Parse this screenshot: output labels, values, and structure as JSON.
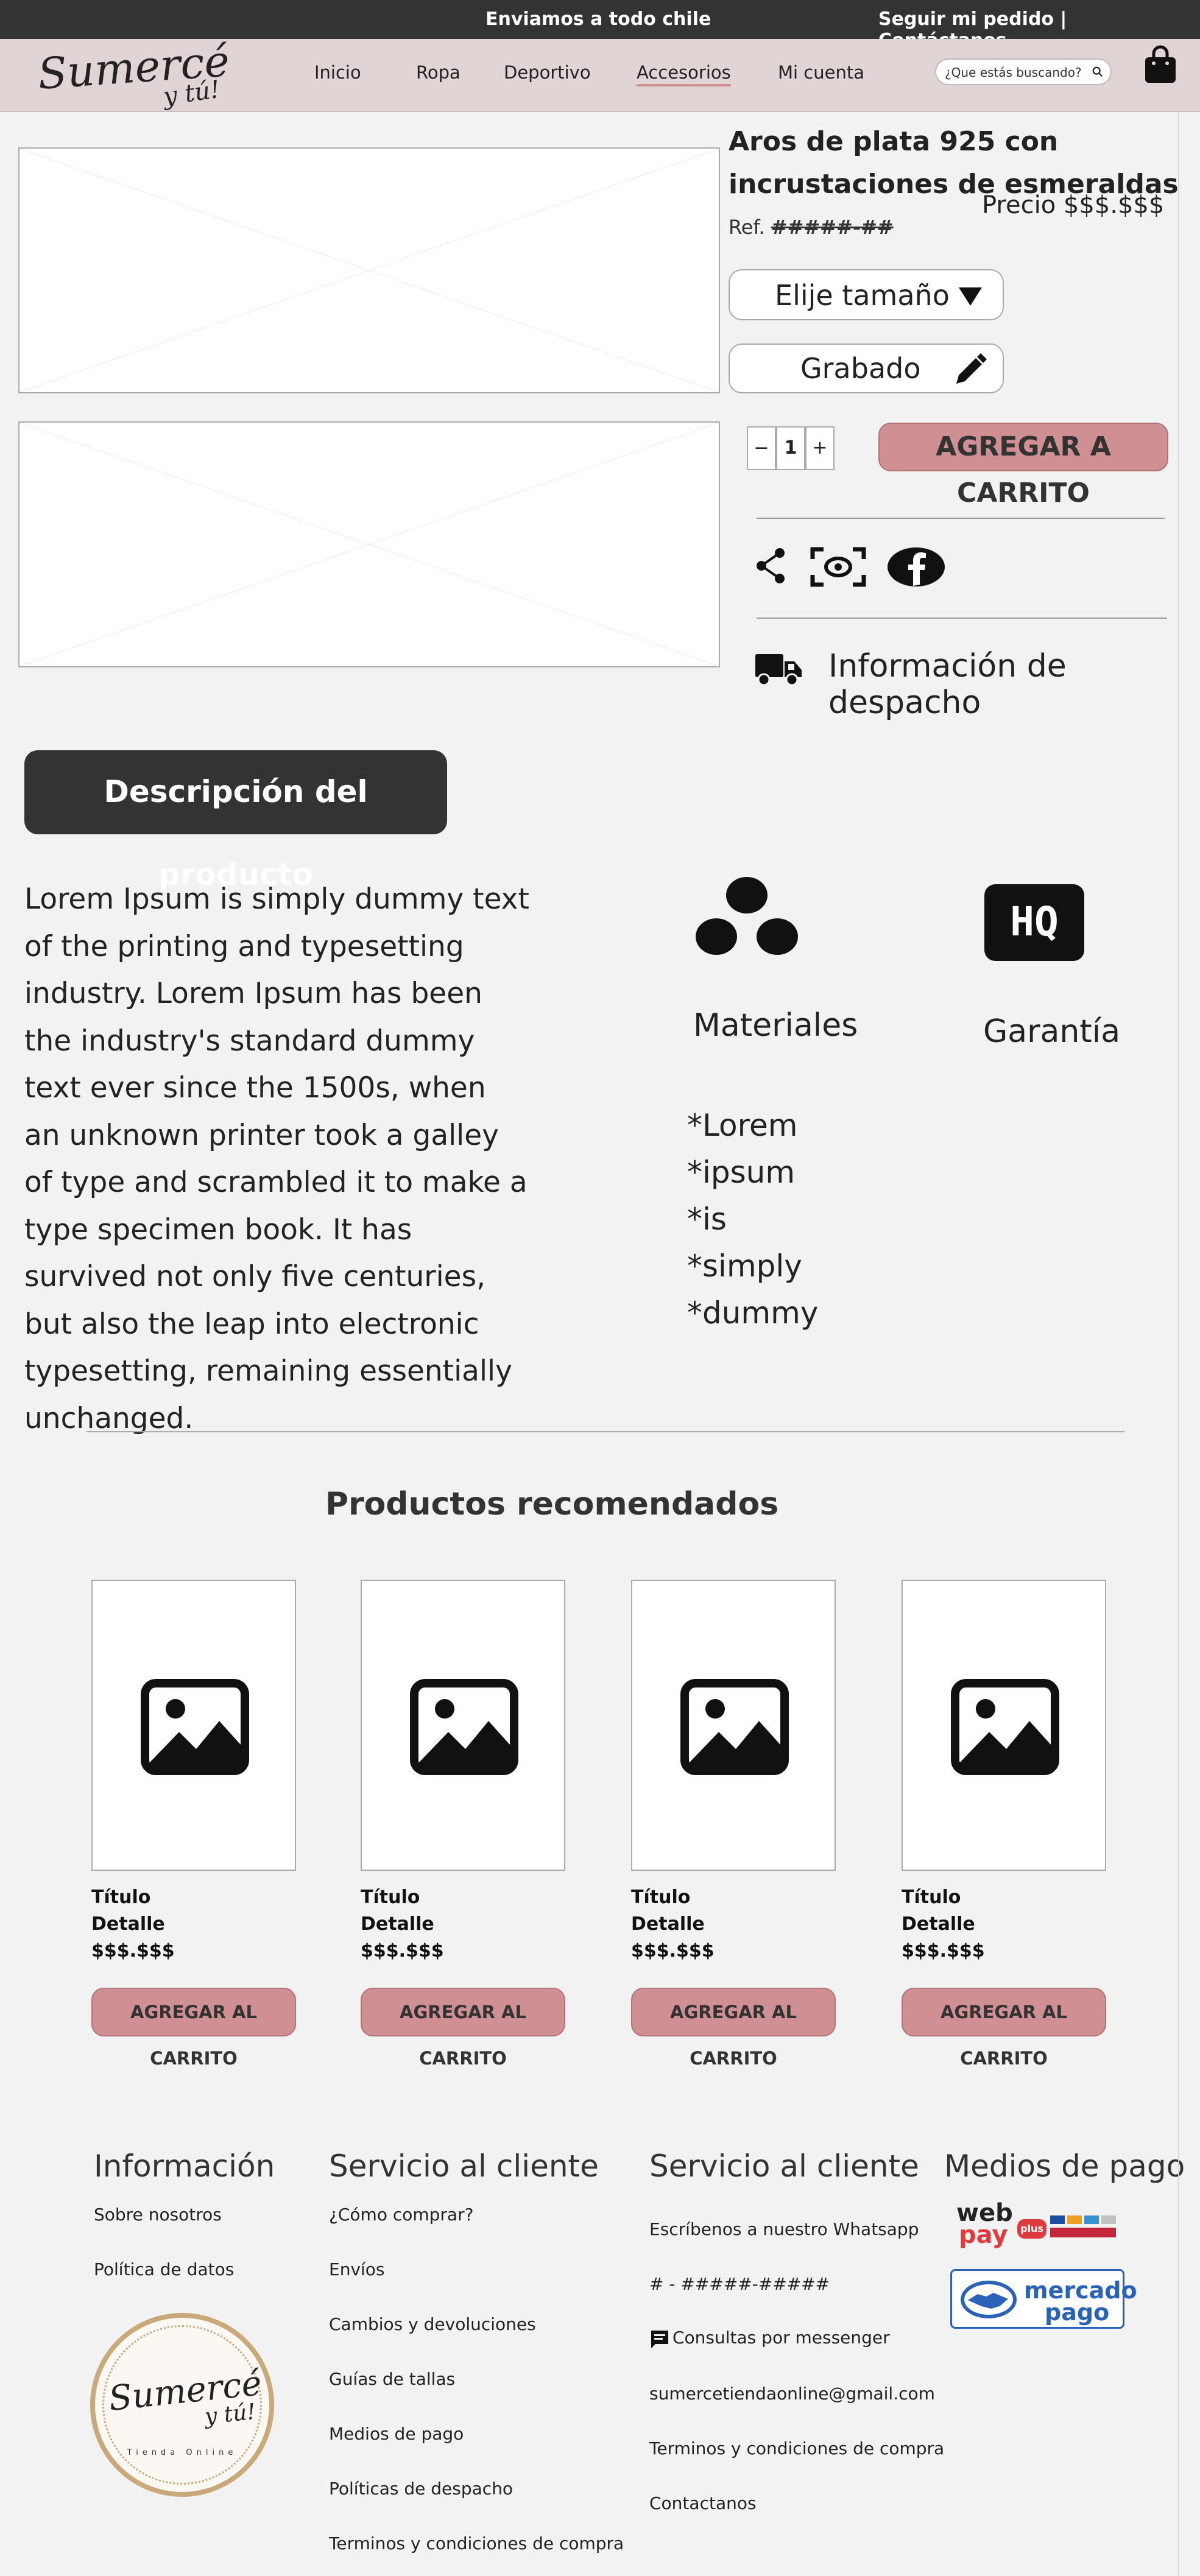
{
  "topbar": {
    "shipping": "Enviamos a todo chile",
    "links": "Seguir mi pedido | Contáctanos"
  },
  "header": {
    "logo_main": "Sumercé",
    "logo_sub": "y tú!",
    "nav": [
      "Inicio",
      "Ropa",
      "Deportivo",
      "Accesorios",
      "Mi cuenta"
    ],
    "active_nav": "Accesorios",
    "search_placeholder": "¿Que estás buscando?"
  },
  "product": {
    "title": "Aros de plata 925 con incrustaciones de esmeraldas",
    "ref_label": "Ref.",
    "ref_value": "#####-##",
    "price": "Precio $$$.$$$",
    "size_select": "Elije tamaño",
    "engraving": "Grabado",
    "qty_minus": "−",
    "qty_value": "1",
    "qty_plus": "+",
    "add_to_cart": "AGREGAR A CARRITO",
    "shipping_info": "Información de despacho"
  },
  "description": {
    "tab": "Descripción del producto",
    "text": "Lorem Ipsum is simply dummy text of the printing and typesetting industry. Lorem Ipsum has been the industry's standard dummy text ever since the 1500s, when an unknown printer took a galley of type and scrambled it to make a type specimen book. It has survived not only five centuries, but also the leap into electronic typesetting, remaining essentially unchanged.",
    "materials_label": "Materiales",
    "warranty_label": "Garantía",
    "warranty_icon_text": "HQ",
    "materials_list": [
      "*Lorem",
      "*ipsum",
      "*is",
      "*simply",
      "*dummy"
    ]
  },
  "recommended": {
    "heading": "Productos recomendados",
    "products": [
      {
        "title": "Título",
        "detail": "Detalle",
        "price": "$$$.$$$",
        "button": "AGREGAR AL CARRITO"
      },
      {
        "title": "Título",
        "detail": "Detalle",
        "price": "$$$.$$$",
        "button": "AGREGAR AL CARRITO"
      },
      {
        "title": "Título",
        "detail": "Detalle",
        "price": "$$$.$$$",
        "button": "AGREGAR AL CARRITO"
      },
      {
        "title": "Título",
        "detail": "Detalle",
        "price": "$$$.$$$",
        "button": "AGREGAR AL CARRITO"
      }
    ]
  },
  "footer": {
    "info": {
      "heading": "Información",
      "links": [
        "Sobre nosotros",
        "Política de datos"
      ],
      "badge_main": "Sumercé",
      "badge_sub": "y tú!",
      "badge_ring": "Tienda Online"
    },
    "service1": {
      "heading": "Servicio al cliente",
      "links": [
        "¿Cómo comprar?",
        "Envíos",
        "Cambios y devoluciones",
        "Guías de tallas",
        "Medios de pago",
        "Políticas de despacho",
        "Terminos y condiciones de compra"
      ]
    },
    "service2": {
      "heading": "Servicio al cliente",
      "links": [
        "Escríbenos a nuestro Whatsapp",
        "# - #####-#####",
        "Consultas por messenger",
        "sumercetiendaonline@gmail.com",
        "Terminos y condiciones de compra",
        "Contactanos"
      ]
    },
    "payment": {
      "heading": "Medios de pago",
      "webpay_1": "web",
      "webpay_2": "pay",
      "webpay_plus": "plus",
      "mercado_1": "mercado",
      "mercado_2": "pago"
    }
  },
  "colors": {
    "topbar": "#333333",
    "header": "#e0d4d4",
    "accent": "#d08f92",
    "background": "#f2f2f2"
  }
}
